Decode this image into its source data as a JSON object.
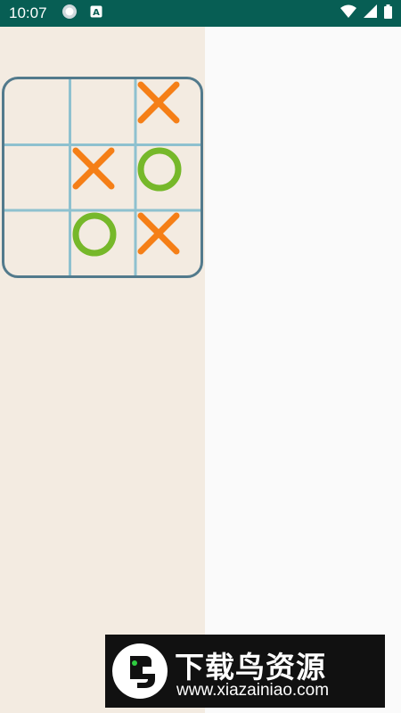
{
  "status_bar": {
    "time": "10:07",
    "icons": [
      "circle-notification-icon",
      "a-badge-icon",
      "wifi-icon",
      "cell-signal-icon",
      "battery-icon"
    ]
  },
  "colors": {
    "status_bar": "#075e54",
    "left_panel": "#f3ebe1",
    "right_panel": "#fafafa",
    "board_border": "#527a8c",
    "grid_line": "#8ec1cf",
    "x_mark": "#f57f17",
    "o_mark": "#76b82a"
  },
  "board": {
    "cells": [
      [
        "",
        "",
        "X"
      ],
      [
        "",
        "X",
        "O"
      ],
      [
        "",
        "O",
        "X"
      ]
    ]
  },
  "watermark": {
    "title": "下载鸟资源",
    "url": "www.xiazainiao.com"
  }
}
